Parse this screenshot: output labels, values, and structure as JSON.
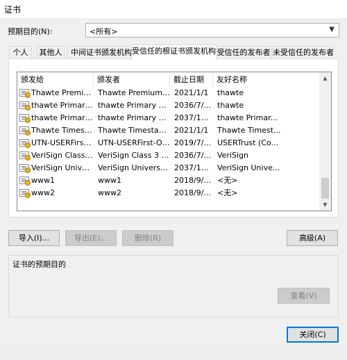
{
  "window": {
    "title": "证书"
  },
  "purpose": {
    "label": "预期目的(N):",
    "value": "<所有>"
  },
  "tabs": [
    {
      "label": "个人"
    },
    {
      "label": "其他人"
    },
    {
      "label": "中间证书颁发机构"
    },
    {
      "label": "受信任的根证书颁发机构"
    },
    {
      "label": "受信任的发布者"
    },
    {
      "label": "未受信任的发布者"
    }
  ],
  "columns": [
    "颁发给",
    "颁发者",
    "截止日期",
    "友好名称"
  ],
  "rows": [
    [
      "Thawte Premium...",
      "Thawte Premium S...",
      "2021/1/1",
      "thawte"
    ],
    [
      "thawte Primary ...",
      "thawte Primary Ro...",
      "2036/7/...",
      "thawte"
    ],
    [
      "thawte Primary ...",
      "thawte Primary Ro...",
      "2037/12...",
      "thawte Primar..."
    ],
    [
      "Thawte Timesta...",
      "Thawte Timestamp...",
      "2021/1/1",
      "Thawte Timest..."
    ],
    [
      "UTN-USERFirst-...",
      "UTN-USERFirst-Ob...",
      "2019/7/...",
      "USERTrust (Co..."
    ],
    [
      "VeriSign Class 3 ...",
      "VeriSign Class 3 P...",
      "2036/7/...",
      "VeriSign"
    ],
    [
      "VeriSign Univers...",
      "VeriSign Universal ...",
      "2037/12...",
      "VeriSign Unive..."
    ],
    [
      "www1",
      "www1",
      "2018/9/...",
      "<无>"
    ],
    [
      "www2",
      "www2",
      "2018/9/...",
      "<无>"
    ]
  ],
  "buttons": {
    "import": "导入(I)...",
    "export": "导出(E)...",
    "delete": "删除(R)",
    "advanced": "高级(A)",
    "view": "查看(V)",
    "close": "关闭(C)"
  },
  "group": {
    "title": "证书的预期目的"
  },
  "colors": {
    "accent": "#0078d7",
    "window_bg": "#f0f0f0"
  }
}
